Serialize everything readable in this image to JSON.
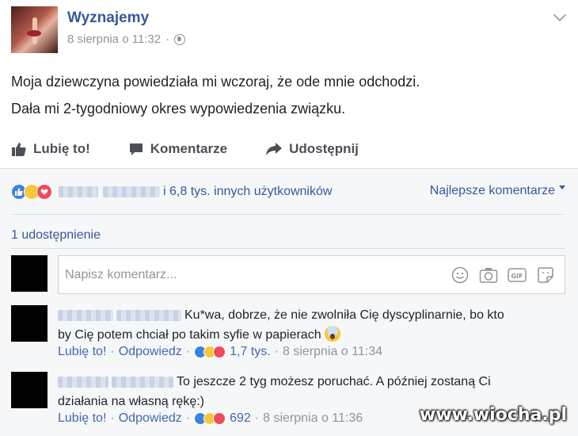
{
  "post": {
    "page_name": "Wyznajemy",
    "date": "8 sierpnia o 11:32",
    "separator": "·",
    "lines": [
      "Moja dziewczyna powiedziała mi wczoraj, że ode mnie odchodzi.",
      "Dała mi 2-tygodniowy okres wypowiedzenia związku."
    ]
  },
  "actions": {
    "like": "Lubię to!",
    "comment": "Komentarze",
    "share": "Udostępnij"
  },
  "reactions": {
    "summary": "i 6,8 tys. innych użytkowników",
    "sort": "Najlepsze komentarze"
  },
  "shares": "1 udostępnienie",
  "composer": {
    "placeholder": "Napisz komentarz..."
  },
  "comments": [
    {
      "text_line1": "Ku*wa, dobrze, że nie zwolniła Cię dyscyplinarnie, bo kto",
      "text_line2": "by Cię potem chciał po takim syfie w papierach",
      "like": "Lubię to!",
      "reply": "Odpowiedz",
      "count": "1,7 tys.",
      "date": "8 sierpnia o 11:34"
    },
    {
      "text_line1": "To jeszcze 2 tyg możesz poruchać. A później zostaną Ci",
      "text_line2": "działania na własną rękę:)",
      "like": "Lubię to!",
      "reply": "Odpowiedz",
      "count": "692",
      "date": "8 sierpnia o 11:36"
    }
  ],
  "watermark": "www.wiocha.pl",
  "colors": {
    "link": "#365899",
    "muted": "#90949c",
    "like_blue": "#3b82e5",
    "love_red": "#f04a5a",
    "haha_yellow": "#f7c737"
  }
}
